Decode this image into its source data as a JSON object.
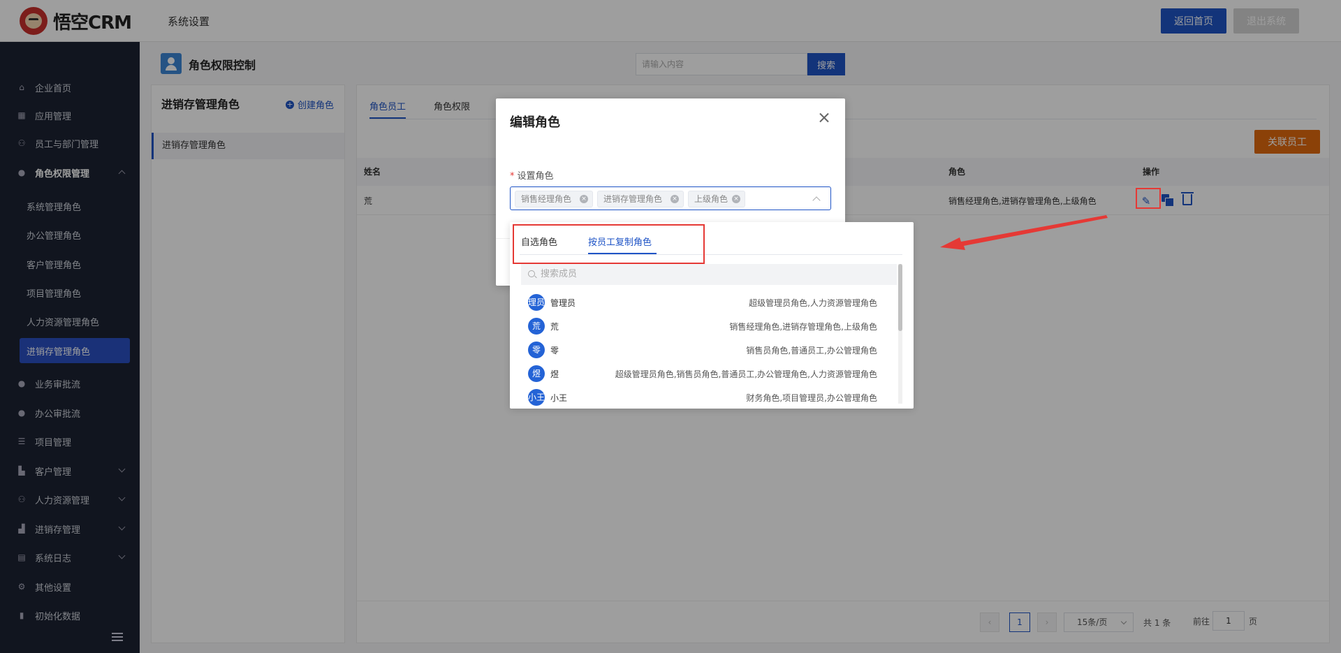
{
  "header": {
    "logo_text": "悟空CRM",
    "system_title": "系统设置",
    "home_button": "返回首页",
    "logout_button": "退出系统"
  },
  "sidebar": {
    "items": [
      {
        "label": "企业首页",
        "icon": "home-icon"
      },
      {
        "label": "应用管理",
        "icon": "grid-icon"
      },
      {
        "label": "员工与部门管理",
        "icon": "users-icon"
      },
      {
        "label": "角色权限管理",
        "icon": "user-icon"
      },
      {
        "label": "业务审批流",
        "icon": "user-icon"
      },
      {
        "label": "办公审批流",
        "icon": "user-icon"
      },
      {
        "label": "项目管理",
        "icon": "list-icon"
      },
      {
        "label": "客户管理",
        "icon": "building-icon"
      },
      {
        "label": "人力资源管理",
        "icon": "users-icon"
      },
      {
        "label": "进销存管理",
        "icon": "truck-icon"
      },
      {
        "label": "系统日志",
        "icon": "log-icon"
      },
      {
        "label": "其他设置",
        "icon": "gear-icon"
      },
      {
        "label": "初始化数据",
        "icon": "chart-icon"
      }
    ],
    "sub_items": [
      "系统管理角色",
      "办公管理角色",
      "客户管理角色",
      "项目管理角色",
      "人力资源管理角色",
      "进销存管理角色"
    ]
  },
  "page": {
    "title": "角色权限控制",
    "search_placeholder": "请输入内容",
    "search_button": "搜索"
  },
  "role_panel": {
    "title": "进销存管理角色",
    "create_label": "创建角色",
    "selected_role": "进销存管理角色"
  },
  "main": {
    "tabs": [
      "角色员工",
      "角色权限"
    ],
    "link_button": "关联员工",
    "columns": {
      "name": "姓名",
      "role": "角色",
      "ops": "操作"
    },
    "row": {
      "name": "荒",
      "roles": "销售经理角色,进销存管理角色,上级角色"
    },
    "pagination": {
      "current": "1",
      "page_size": "15条/页",
      "total": "共 1 条",
      "goto_prefix": "前往",
      "goto_value": "1",
      "goto_suffix": "页"
    }
  },
  "dialog": {
    "title": "编辑角色",
    "field_label": "设置角色",
    "chips": [
      "销售经理角色",
      "进销存管理角色",
      "上级角色"
    ]
  },
  "dropdown": {
    "tabs": [
      "自选角色",
      "按员工复制角色"
    ],
    "search_placeholder": "搜索成员",
    "members": [
      {
        "avatar": "理员",
        "name": "管理员",
        "roles": "超级管理员角色,人力资源管理角色"
      },
      {
        "avatar": "荒",
        "name": "荒",
        "roles": "销售经理角色,进销存管理角色,上级角色"
      },
      {
        "avatar": "零",
        "name": "零",
        "roles": "销售员角色,普通员工,办公管理角色"
      },
      {
        "avatar": "煜",
        "name": "煜",
        "roles": "超级管理员角色,销售员角色,普通员工,办公管理角色,人力资源管理角色"
      },
      {
        "avatar": "小王",
        "name": "小王",
        "roles": "财务角色,项目管理员,办公管理角色"
      }
    ]
  },
  "colors": {
    "primary": "#1f54c6",
    "sidebar_bg": "#1c2333",
    "accent_orange": "#e06a0e",
    "highlight_red": "#e53935"
  }
}
